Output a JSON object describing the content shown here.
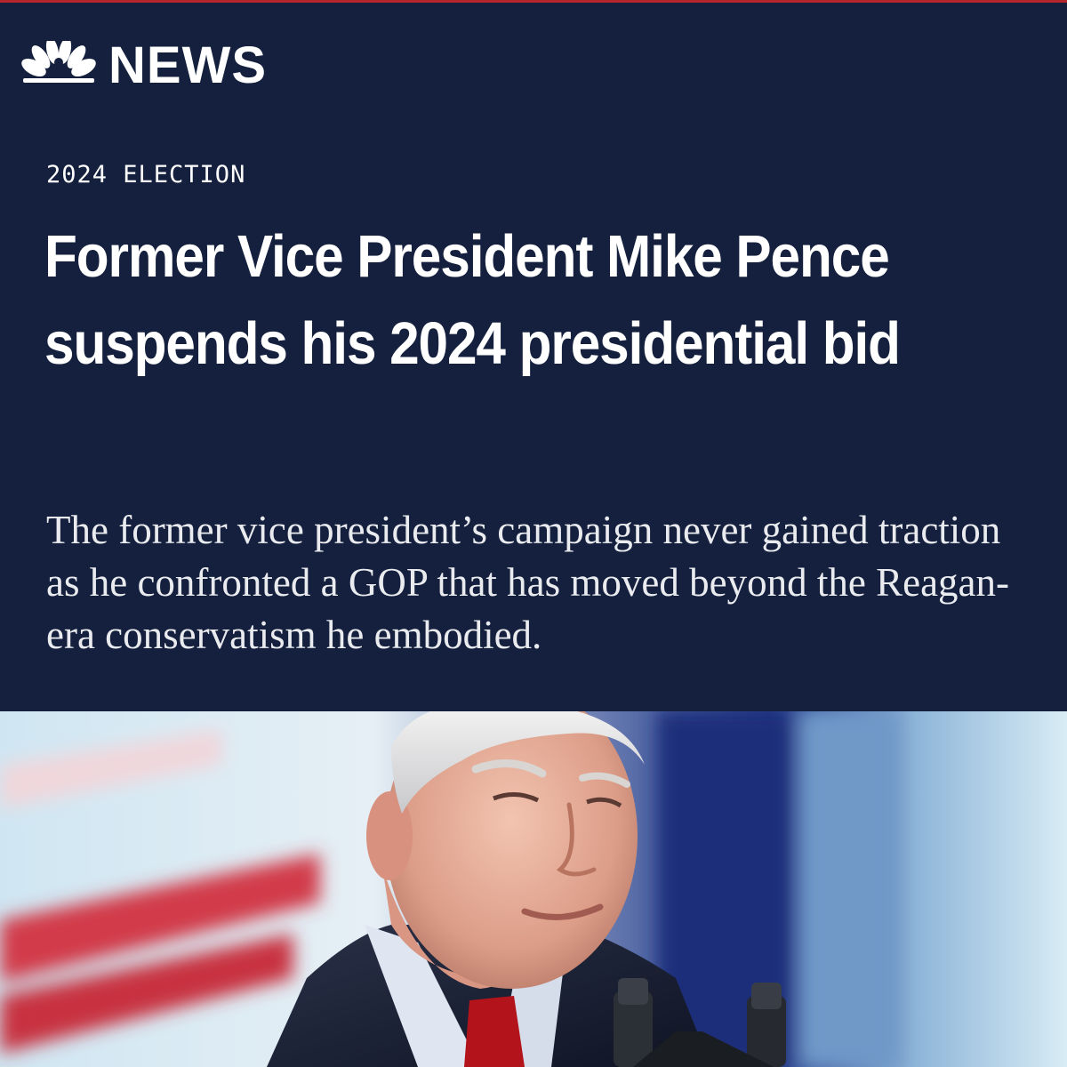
{
  "brand": {
    "logo_icon": "peacock-icon",
    "name": "NEWS",
    "accent_color": "#b5252b",
    "background_color": "#14203d"
  },
  "article": {
    "kicker": "2024 ELECTION",
    "headline": "Former Vice President Mike Pence suspends his 2024 presidential bid",
    "dek": "The former vice president’s campaign never gained traction as he confronted a GOP that has moved beyond the Reagan-era conservatism he embodied."
  }
}
